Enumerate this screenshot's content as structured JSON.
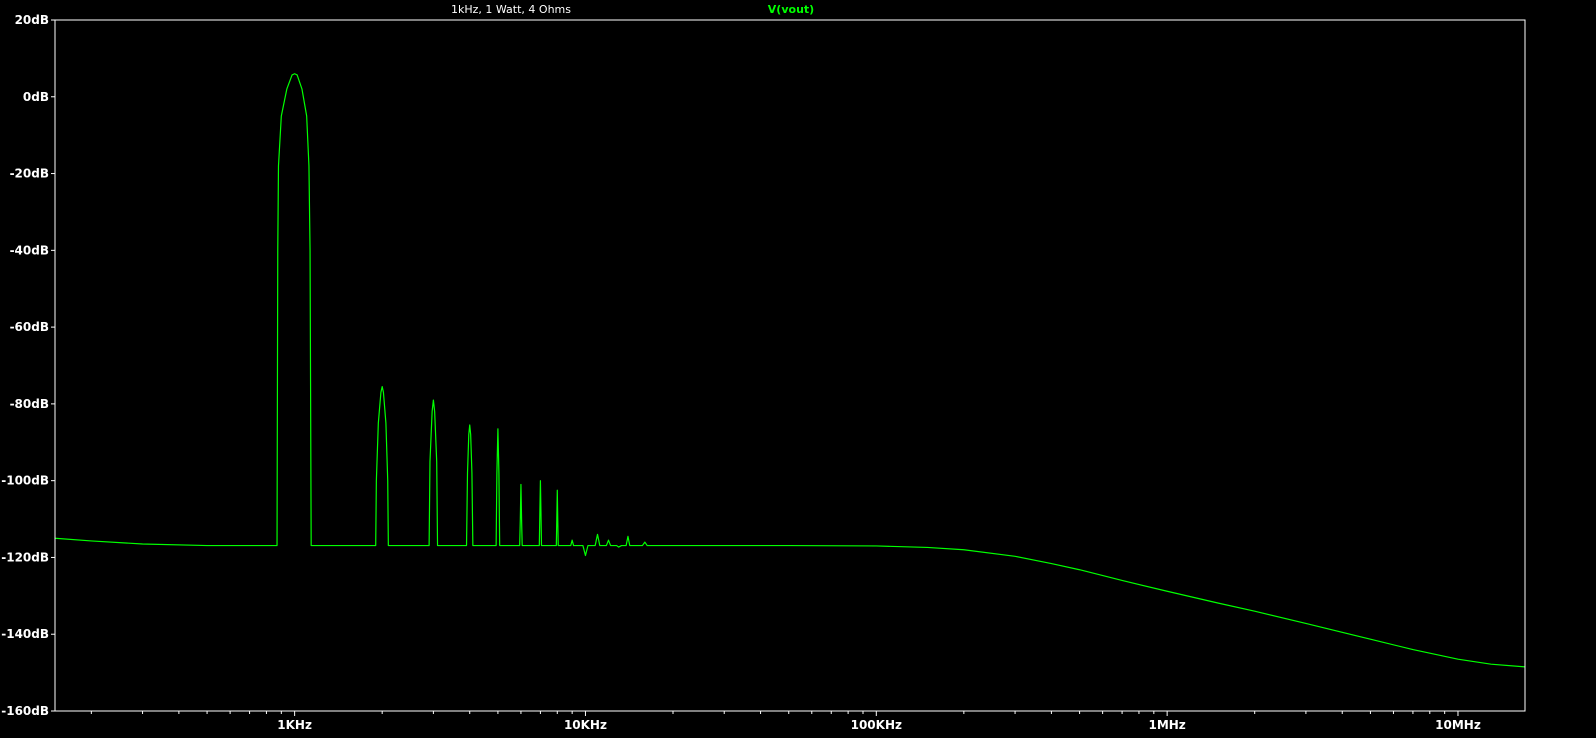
{
  "colors": {
    "background": "#000000",
    "frame": "#ffffff",
    "trace": "#00ff00",
    "text": "#ffffff"
  },
  "chart_data": {
    "type": "line",
    "title": "1kHz, 1 Watt, 4 Ohms",
    "xlabel": "",
    "ylabel": "",
    "x_scale": "log",
    "xlim": [
      150,
      17000000
    ],
    "ylim": [
      -160,
      20
    ],
    "grid": false,
    "legend_position": "top-center",
    "x_ticks": [
      {
        "value": 1000,
        "label": "1KHz"
      },
      {
        "value": 10000,
        "label": "10KHz"
      },
      {
        "value": 100000,
        "label": "100KHz"
      },
      {
        "value": 1000000,
        "label": "1MHz"
      },
      {
        "value": 10000000,
        "label": "10MHz"
      }
    ],
    "y_ticks": [
      {
        "value": 20,
        "label": "20dB"
      },
      {
        "value": 0,
        "label": "0dB"
      },
      {
        "value": -20,
        "label": "-20dB"
      },
      {
        "value": -40,
        "label": "-40dB"
      },
      {
        "value": -60,
        "label": "-60dB"
      },
      {
        "value": -80,
        "label": "-80dB"
      },
      {
        "value": -100,
        "label": "-100dB"
      },
      {
        "value": -120,
        "label": "-120dB"
      },
      {
        "value": -140,
        "label": "-140dB"
      },
      {
        "value": -160,
        "label": "-160dB"
      }
    ],
    "series": [
      {
        "name": "V(vout)",
        "color": "#00ff00",
        "points": [
          [
            150,
            -115.0
          ],
          [
            200,
            -115.7
          ],
          [
            300,
            -116.5
          ],
          [
            500,
            -116.9
          ],
          [
            870,
            -116.9
          ],
          [
            875,
            -40
          ],
          [
            880,
            -18
          ],
          [
            900,
            -5
          ],
          [
            940,
            2
          ],
          [
            980,
            5.7
          ],
          [
            1000,
            6.0
          ],
          [
            1020,
            5.7
          ],
          [
            1060,
            2
          ],
          [
            1100,
            -5
          ],
          [
            1120,
            -18
          ],
          [
            1130,
            -40
          ],
          [
            1140,
            -116.9
          ],
          [
            1900,
            -116.9
          ],
          [
            1910,
            -100
          ],
          [
            1940,
            -85
          ],
          [
            1980,
            -77
          ],
          [
            2000,
            -75.5
          ],
          [
            2020,
            -77
          ],
          [
            2060,
            -85
          ],
          [
            2090,
            -100
          ],
          [
            2100,
            -116.9
          ],
          [
            2900,
            -116.9
          ],
          [
            2920,
            -95
          ],
          [
            2970,
            -82
          ],
          [
            3000,
            -79
          ],
          [
            3030,
            -82
          ],
          [
            3080,
            -95
          ],
          [
            3100,
            -116.9
          ],
          [
            3900,
            -116.9
          ],
          [
            3930,
            -98
          ],
          [
            3970,
            -88
          ],
          [
            4000,
            -85.5
          ],
          [
            4030,
            -88
          ],
          [
            4070,
            -98
          ],
          [
            4100,
            -116.9
          ],
          [
            4930,
            -116.9
          ],
          [
            4960,
            -98
          ],
          [
            5000,
            -86.5
          ],
          [
            5040,
            -98
          ],
          [
            5070,
            -116.9
          ],
          [
            5940,
            -116.9
          ],
          [
            5970,
            -110
          ],
          [
            6000,
            -101
          ],
          [
            6030,
            -110
          ],
          [
            6060,
            -116.9
          ],
          [
            6940,
            -116.9
          ],
          [
            6970,
            -108
          ],
          [
            7000,
            -100
          ],
          [
            7030,
            -108
          ],
          [
            7060,
            -116.9
          ],
          [
            7940,
            -116.9
          ],
          [
            7970,
            -110
          ],
          [
            8000,
            -102.5
          ],
          [
            8030,
            -110
          ],
          [
            8060,
            -116.9
          ],
          [
            8900,
            -116.9
          ],
          [
            9000,
            -115.5
          ],
          [
            9100,
            -116.9
          ],
          [
            9800,
            -116.9
          ],
          [
            10000,
            -119.5
          ],
          [
            10200,
            -116.9
          ],
          [
            10800,
            -116.9
          ],
          [
            11000,
            -114
          ],
          [
            11200,
            -116.9
          ],
          [
            11800,
            -116.9
          ],
          [
            12000,
            -115.5
          ],
          [
            12200,
            -116.9
          ],
          [
            12800,
            -116.9
          ],
          [
            13000,
            -117.3
          ],
          [
            13300,
            -116.9
          ],
          [
            13800,
            -116.9
          ],
          [
            14000,
            -114.5
          ],
          [
            14200,
            -116.9
          ],
          [
            15700,
            -116.9
          ],
          [
            16000,
            -116
          ],
          [
            16300,
            -116.9
          ],
          [
            20000,
            -116.9
          ],
          [
            50000,
            -116.9
          ],
          [
            100000,
            -117.0
          ],
          [
            150000,
            -117.4
          ],
          [
            200000,
            -118.0
          ],
          [
            300000,
            -119.7
          ],
          [
            400000,
            -121.6
          ],
          [
            500000,
            -123.2
          ],
          [
            700000,
            -126.0
          ],
          [
            1000000,
            -128.8
          ],
          [
            1500000,
            -131.9
          ],
          [
            2000000,
            -134.0
          ],
          [
            3000000,
            -137.2
          ],
          [
            5000000,
            -141.3
          ],
          [
            7000000,
            -144.0
          ],
          [
            10000000,
            -146.5
          ],
          [
            13000000,
            -147.8
          ],
          [
            17000000,
            -148.5
          ]
        ]
      }
    ]
  }
}
